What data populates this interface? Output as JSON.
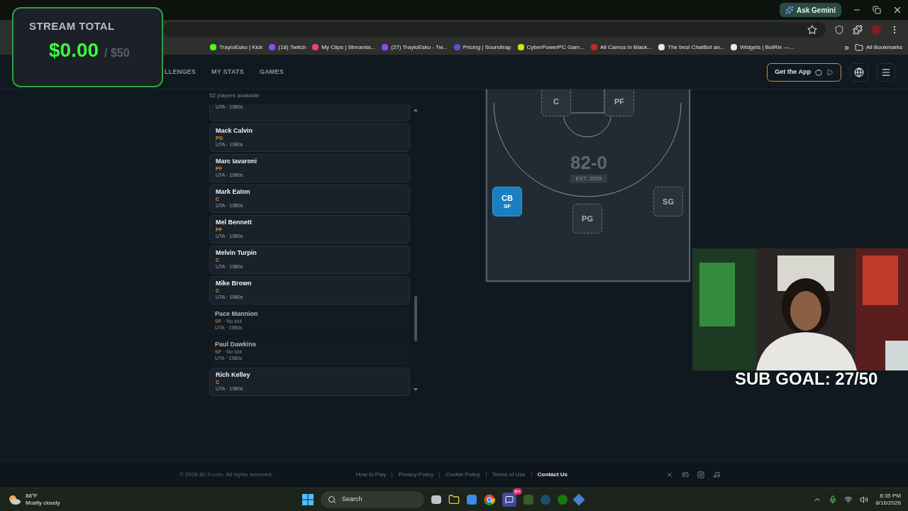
{
  "browser": {
    "ask_button": "Ask Gemini",
    "bookmarks": [
      {
        "label": "TrayloEsko | Kick",
        "color": "#53fc18"
      },
      {
        "label": "(18) Twitch",
        "color": "#9146ff"
      },
      {
        "label": "My Clips | Streamla...",
        "color": "#e83e8c"
      },
      {
        "label": "(27) TrayloEsko - Tw...",
        "color": "#9146ff"
      },
      {
        "label": "Pricing | Soundtrap",
        "color": "#5a4fcf"
      },
      {
        "label": "CyberPowerPC Gam...",
        "color": "#d4e01a"
      },
      {
        "label": "All Camos in Black...",
        "color": "#c0282d"
      },
      {
        "label": "The best ChatBot an...",
        "color": "#e8e8e8"
      },
      {
        "label": "Widgets | BotRix —...",
        "color": "#e8e8e8"
      }
    ],
    "more": "»",
    "all_bookmarks": "All Bookmarks"
  },
  "overlay": {
    "title": "STREAM TOTAL",
    "amount": "$0.00",
    "goal": "/ $50"
  },
  "nav": {
    "items": [
      {
        "label": "LLENGES"
      },
      {
        "label": "MY STATS"
      },
      {
        "label": "GAMES"
      }
    ],
    "app_button": "Get the App"
  },
  "players": {
    "count": "52 players available",
    "rows": [
      {
        "team": "UTA · 1980s",
        "disabled": false
      },
      {
        "name": "Mack Calvin",
        "position": "PG",
        "team": "UTA · 1980s",
        "disabled": false
      },
      {
        "name": "Marc Iavaroni",
        "position": "PF",
        "team": "UTA · 1980s",
        "disabled": false
      },
      {
        "name": "Mark Eaton",
        "position": "C",
        "team": "UTA · 1980s",
        "disabled": false
      },
      {
        "name": "Mel Bennett",
        "position": "PF",
        "team": "UTA · 1980s",
        "disabled": false
      },
      {
        "name": "Melvin Turpin",
        "position": "C",
        "team": "UTA · 1980s",
        "disabled": false
      },
      {
        "name": "Mike Brown",
        "position": "C",
        "team": "UTA · 1980s",
        "disabled": false
      },
      {
        "name": "Pace Mannion",
        "position": "SF",
        "note": "· No slot",
        "team": "UTA · 1980s",
        "disabled": true
      },
      {
        "name": "Paul Dawkins",
        "position": "SF",
        "note": "· No slot",
        "team": "UTA · 1980s",
        "disabled": true
      },
      {
        "name": "Rich Kelley",
        "position": "C",
        "team": "UTA · 1980s",
        "disabled": false
      }
    ]
  },
  "court": {
    "logo": "82-0",
    "logo_sub": "EST. 2025",
    "slots": [
      {
        "label": "C",
        "filled": false
      },
      {
        "label": "PF",
        "filled": false
      },
      {
        "label": "CB",
        "sub": "SF",
        "filled": true
      },
      {
        "label": "PG",
        "filled": false
      },
      {
        "label": "SG",
        "filled": false
      }
    ]
  },
  "sub_goal": "SUB GOAL: 27/50",
  "footer": {
    "copyright": "© 2026 82-0.com. All rights reserved.",
    "links": [
      {
        "label": "How to Play",
        "emphasis": false
      },
      {
        "label": "Privacy Policy",
        "emphasis": false
      },
      {
        "label": "Cookie Policy",
        "emphasis": false
      },
      {
        "label": "Terms of Use",
        "emphasis": false
      },
      {
        "label": "Contact Us",
        "emphasis": true
      }
    ]
  },
  "taskbar": {
    "temperature": "88°F",
    "condition": "Mostly cloudy",
    "search": "Search",
    "discord_badge": "9+",
    "time": "8:35 PM",
    "date": "8/16/2026"
  }
}
